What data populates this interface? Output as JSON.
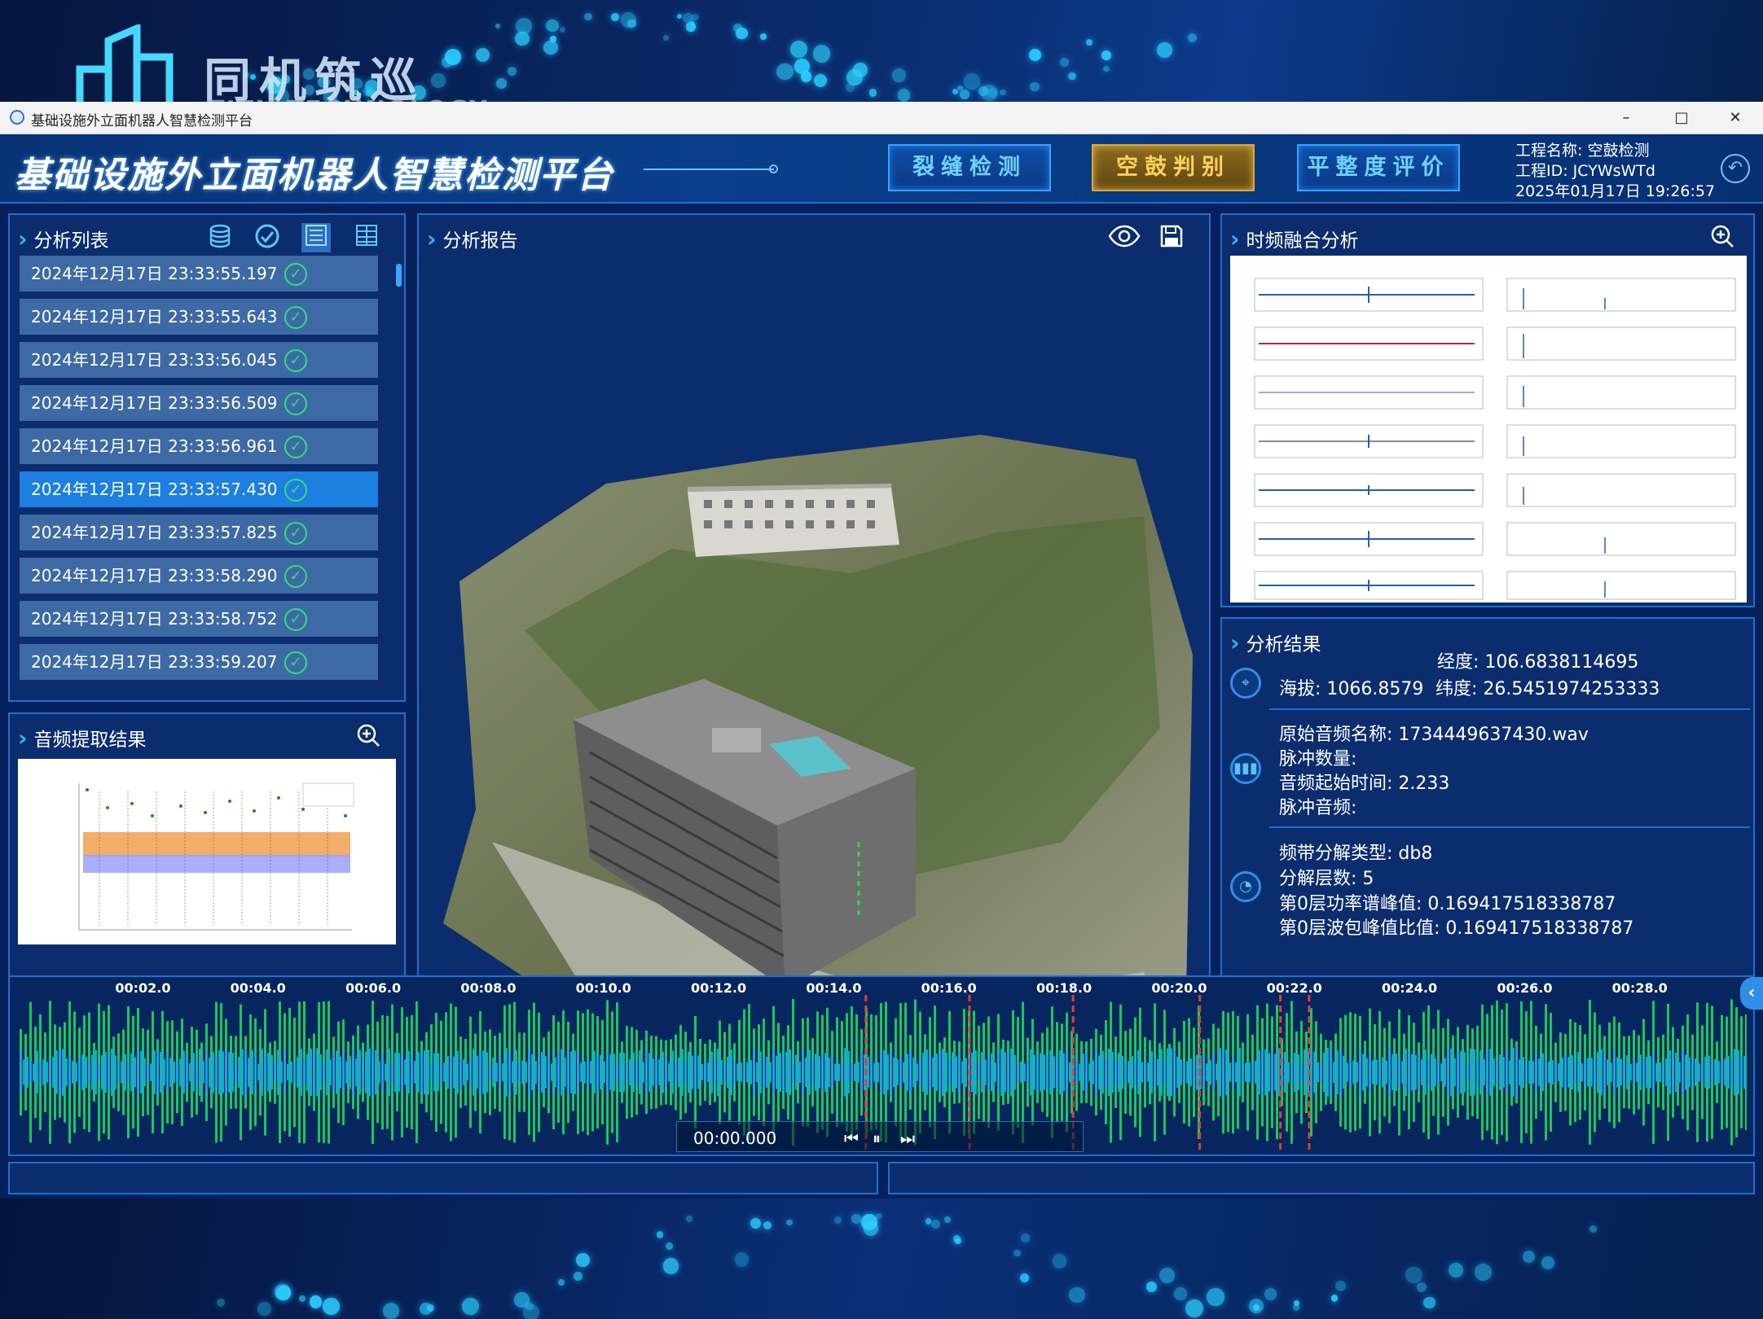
{
  "brand": {
    "name": "同机筑巡",
    "subtitle": "TJZX TECHNOLOGY"
  },
  "window": {
    "title": "基础设施外立面机器人智慧检测平台",
    "minimize": "–",
    "maximize": "□",
    "close": "✕"
  },
  "header": {
    "app_title": "基础设施外立面机器人智慧检测平台",
    "nav": [
      {
        "label": "裂缝检测",
        "active": false
      },
      {
        "label": "空鼓判别",
        "active": true
      },
      {
        "label": "平整度评价",
        "active": false
      }
    ],
    "project_name": "工程名称: 空鼓检测",
    "project_id": "工程ID: JCYWsWTd",
    "datetime": "2025年01月17日 19:26:57"
  },
  "analysis_list": {
    "title": "分析列表",
    "toolbar_icons": [
      "database-icon",
      "check-circle-icon",
      "list-view-icon",
      "grid-view-icon"
    ],
    "items": [
      {
        "label": "2024年12月17日 23:33:55.197",
        "selected": false
      },
      {
        "label": "2024年12月17日 23:33:55.643",
        "selected": false
      },
      {
        "label": "2024年12月17日 23:33:56.045",
        "selected": false
      },
      {
        "label": "2024年12月17日 23:33:56.509",
        "selected": false
      },
      {
        "label": "2024年12月17日 23:33:56.961",
        "selected": false
      },
      {
        "label": "2024年12月17日 23:33:57.430",
        "selected": true
      },
      {
        "label": "2024年12月17日 23:33:57.825",
        "selected": false
      },
      {
        "label": "2024年12月17日 23:33:58.290",
        "selected": false
      },
      {
        "label": "2024年12月17日 23:33:58.752",
        "selected": false
      },
      {
        "label": "2024年12月17日 23:33:59.207",
        "selected": false
      }
    ]
  },
  "audio_extract": {
    "title": "音频提取结果"
  },
  "report": {
    "title": "分析报告"
  },
  "tf_analysis": {
    "title": "时频融合分析"
  },
  "result": {
    "title": "分析结果",
    "longitude": "经度: 106.6838114695",
    "altitude": "海拔:  1066.8579",
    "latitude": "纬度: 26.5451974253333",
    "audio_name": "原始音频名称:  1734449637430.wav",
    "pulse_count": "脉冲数量:",
    "audio_start": "音频起始时间: 2.233",
    "pulse_freq": "脉冲音频:",
    "band_type": "频带分解类型: db8",
    "levels": "分解层数: 5",
    "psd_peak": "第0层功率谱峰值: 0.169417518338787",
    "env_ratio": "第0层波包峰值比值: 0.169417518338787"
  },
  "timeline": {
    "ticks": [
      "00:02.0",
      "00:04.0",
      "00:06.0",
      "00:08.0",
      "00:10.0",
      "00:12.0",
      "00:14.0",
      "00:16.0",
      "00:18.0",
      "00:20.0",
      "00:22.0",
      "00:24.0",
      "00:26.0",
      "00:28.0"
    ],
    "timecode": "00:00.000",
    "prev": "⏮",
    "pause": "⏸",
    "next": "⏭",
    "markers": [
      14.7,
      16.5,
      18.3,
      20.5,
      21.9,
      22.4
    ]
  },
  "colors": {
    "accent": "#1f6fd0",
    "active": "#d6a93a",
    "ok": "#2ee07a",
    "wave": "#18c85a"
  }
}
